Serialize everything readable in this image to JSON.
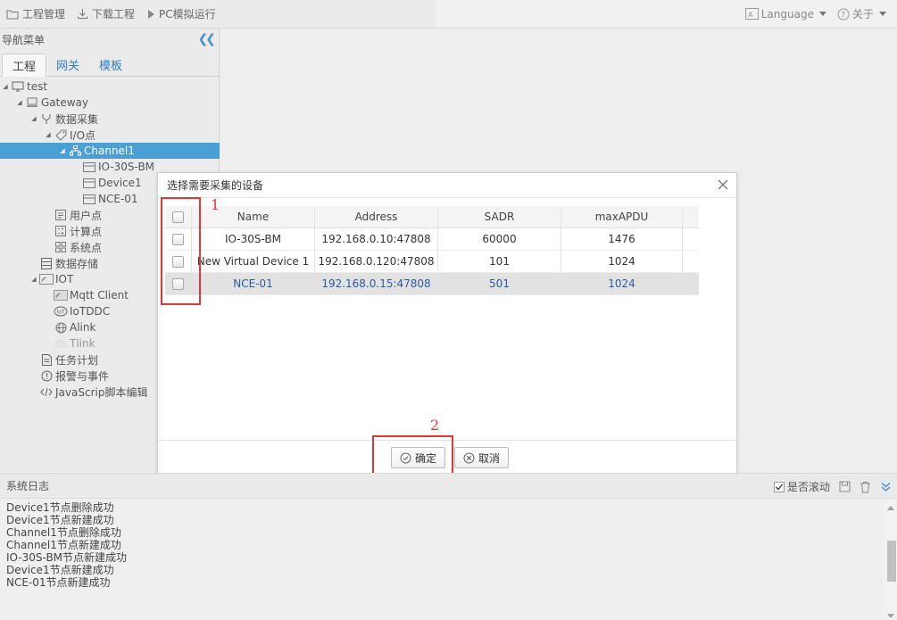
{
  "topbar": {
    "left": [
      {
        "label": "工程管理",
        "icon": "folder-icon"
      },
      {
        "label": "下载工程",
        "icon": "download-icon"
      },
      {
        "label": "PC模拟运行",
        "icon": "play-icon"
      }
    ],
    "language_label": "Language",
    "about_label": "关于"
  },
  "sidebar": {
    "title": "导航菜单",
    "tabs": [
      "工程",
      "网关",
      "模板"
    ],
    "tree": [
      {
        "label": "test",
        "level": 0,
        "icon": "monitor-icon"
      },
      {
        "label": "Gateway",
        "level": 1,
        "icon": "gateway-icon"
      },
      {
        "label": "数据采集",
        "level": 2,
        "icon": "branch-icon"
      },
      {
        "label": "I/O点",
        "level": 3,
        "icon": "tag-icon"
      },
      {
        "label": "Channel1",
        "level": 4,
        "icon": "network-icon",
        "selected": true
      },
      {
        "label": "IO-30S-BM",
        "level": 5,
        "icon": "device-icon"
      },
      {
        "label": "Device1",
        "level": 5,
        "icon": "device-icon"
      },
      {
        "label": "NCE-01",
        "level": 5,
        "icon": "device-icon"
      },
      {
        "label": "用户点",
        "level": 3,
        "icon": "list-icon"
      },
      {
        "label": "计算点",
        "level": 3,
        "icon": "calc-icon"
      },
      {
        "label": "系统点",
        "level": 3,
        "icon": "grid-icon"
      },
      {
        "label": "数据存储",
        "level": 2,
        "icon": "storage-icon"
      },
      {
        "label": "IOT",
        "level": 2,
        "icon": "iot-icon"
      },
      {
        "label": "Mqtt Client",
        "level": 3,
        "icon": "mqtt-icon"
      },
      {
        "label": "IoTDDC",
        "level": 3,
        "icon": "iotddc-icon"
      },
      {
        "label": "Alink",
        "level": 3,
        "icon": "globe-icon"
      },
      {
        "label": "Tlink",
        "level": 3,
        "icon": "cloud-icon"
      },
      {
        "label": "任务计划",
        "level": 2,
        "icon": "document-icon"
      },
      {
        "label": "报警与事件",
        "level": 2,
        "icon": "alert-icon"
      },
      {
        "label": "JavaScrip脚本编辑",
        "level": 2,
        "icon": "code-icon"
      }
    ]
  },
  "dialog": {
    "title": "选择需要采集的设备",
    "columns": [
      "Name",
      "Address",
      "SADR",
      "maxAPDU"
    ],
    "rows": [
      {
        "name": "IO-30S-BM",
        "address": "192.168.0.10:47808",
        "sadr": "60000",
        "maxapdu": "1476"
      },
      {
        "name": "New Virtual Device 1",
        "address": "192.168.0.120:47808",
        "sadr": "101",
        "maxapdu": "1024"
      },
      {
        "name": "NCE-01",
        "address": "192.168.0.15:47808",
        "sadr": "501",
        "maxapdu": "1024"
      }
    ],
    "ok_label": "确定",
    "cancel_label": "取消"
  },
  "annotations": {
    "one": "1",
    "two": "2"
  },
  "log": {
    "title": "系统日志",
    "autoscroll_label": "是否滚动",
    "lines": [
      "Device1节点删除成功",
      "Device1节点新建成功",
      "Channel1节点删除成功",
      "Channel1节点新建成功",
      "IO-30S-BM节点新建成功",
      "Device1节点新建成功",
      "NCE-01节点新建成功"
    ]
  },
  "colors": {
    "accent": "#4a9fd5",
    "annotation": "#e0383a",
    "link": "#2f7ec0"
  }
}
